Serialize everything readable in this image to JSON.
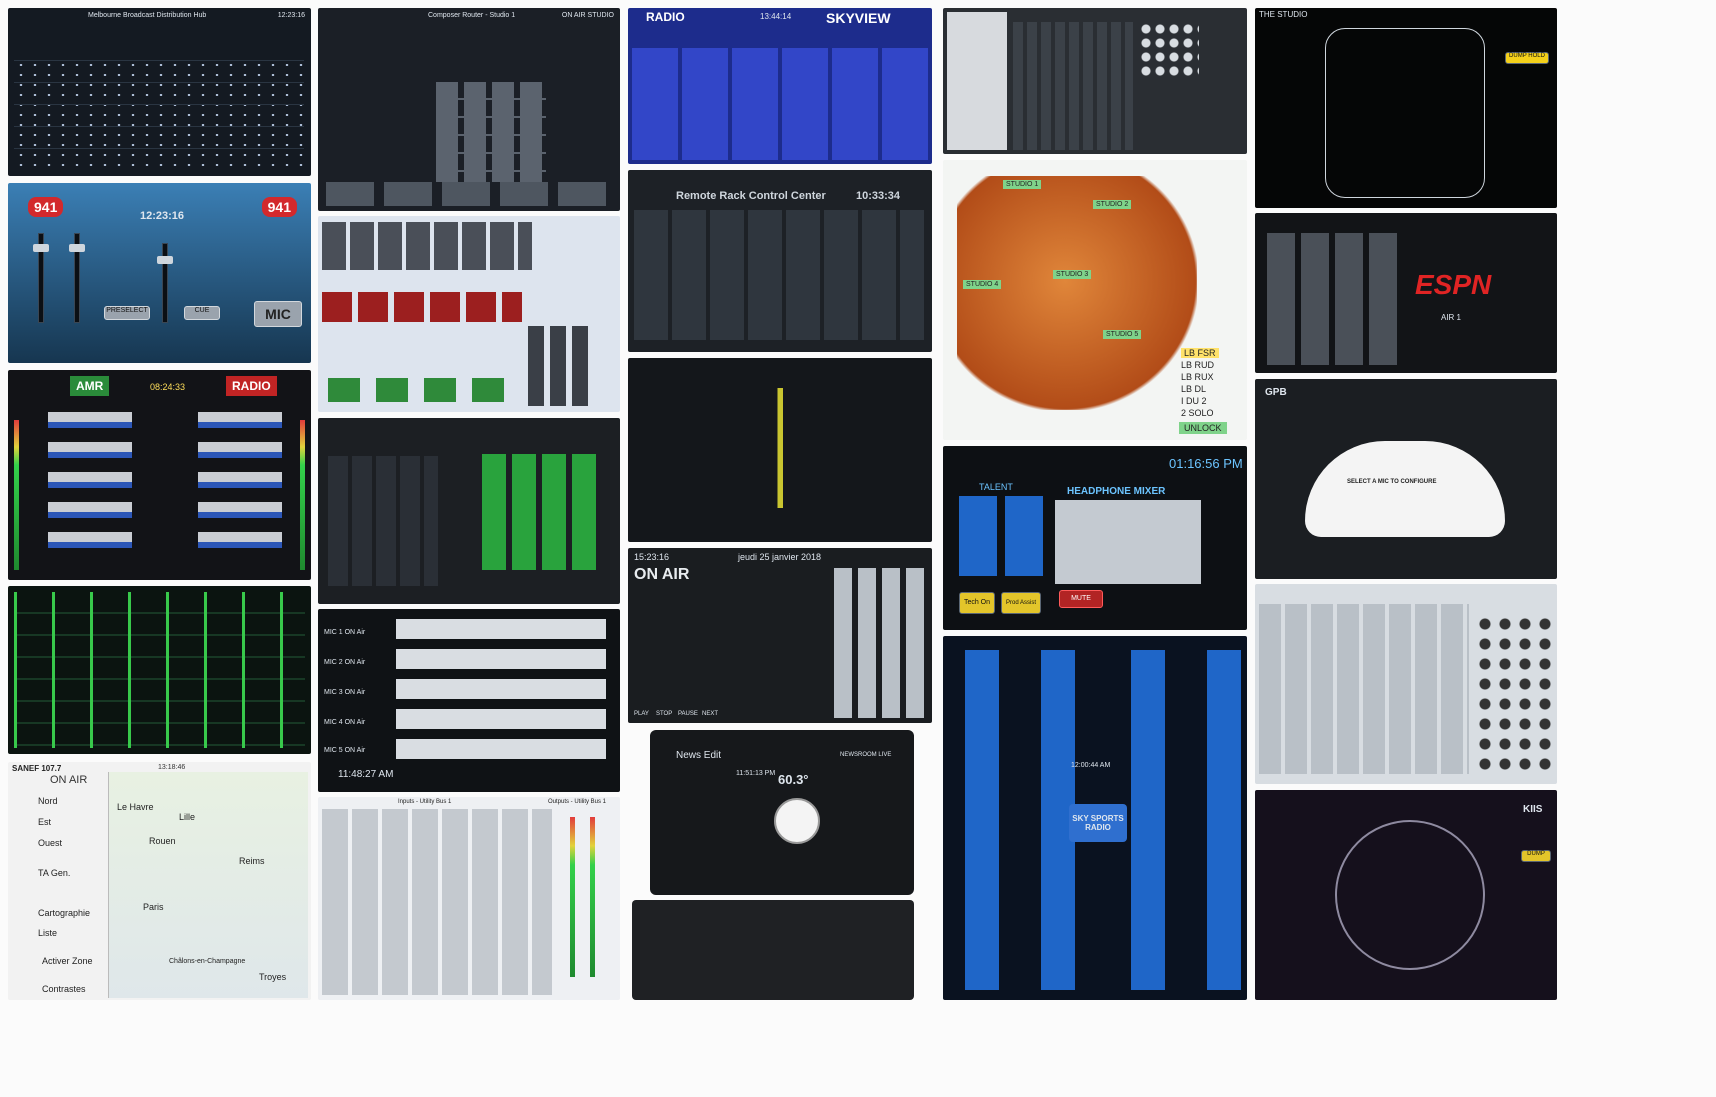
{
  "tiles": {
    "a1": {
      "title": "Melbourne Broadcast Distribution Hub",
      "clock": "12:23:16"
    },
    "a2": {
      "logo": "941",
      "clock": "12:23:16",
      "mic": "MIC",
      "btn1": "PRESELECT",
      "btn2": "CUE"
    },
    "a3": {
      "brand_left": "AMR",
      "brand_right": "RADIO",
      "clock": "08:24:33"
    },
    "a5": {
      "app_title": "SANEF 107.7",
      "status": "ON AIR",
      "clock": "13:18:46",
      "items": [
        "Nord",
        "Est",
        "Ouest",
        "TA Gen.",
        "Cartographie",
        "Liste",
        "Activer Zone",
        "Contrastes"
      ],
      "cities": [
        "Lille",
        "Reims",
        "Paris",
        "Le Havre",
        "Rouen",
        "Châlons-en-Champagne",
        "Troyes"
      ]
    },
    "b1": {
      "title": "Composer Router - Studio 1",
      "label": "ON AIR STUDIO"
    },
    "b5": {
      "clock": "11:48:27 AM",
      "rows": [
        "MIC 1 ON Air",
        "MIC 2 ON Air",
        "MIC 3 ON Air",
        "MIC 4 ON Air",
        "MIC 5 ON Air"
      ]
    },
    "b6": {
      "title_left": "Inputs - Utility Bus 1",
      "title_right": "Outputs - Utility Bus 1"
    },
    "c1": {
      "brand_left": "RADIO",
      "clock": "13:44:14",
      "brand_right": "SKYVIEW"
    },
    "c2": {
      "title": "Remote Rack Control Center",
      "clock": "10:33:34"
    },
    "c4": {
      "clock": "15:23:16",
      "date": "jeudi 25 janvier 2018",
      "status": "ON AIR",
      "transport": [
        "PLAY",
        "STOP",
        "PAUSE",
        "NEXT"
      ]
    },
    "c5": {
      "title": "News Edit",
      "time": "11:51:13 PM",
      "temp": "60.3°",
      "room": "NEWSROOM LIVE"
    },
    "d2": {
      "labels": [
        "STUDIO 1",
        "STUDIO 2",
        "STUDIO 3",
        "STUDIO 4",
        "STUDIO 5"
      ],
      "list": [
        "LB FSR",
        "LB RUD",
        "LB RUX",
        "LB DL",
        "I DU 2",
        "2 SOLO"
      ],
      "action": "UNLOCK"
    },
    "d3": {
      "clock": "01:16:56 PM",
      "talent": "TALENT",
      "mixer": "HEADPHONE MIXER",
      "btn1": "Tech On",
      "btn2": "Prod Assist",
      "mute": "MUTE"
    },
    "d4": {
      "clock": "12:00:44 AM",
      "logo": "SKY SPORTS RADIO"
    },
    "e1": {
      "brand": "THE STUDIO",
      "action": "DUMP HOLD"
    },
    "e2": {
      "brand": "ESPN",
      "sub": "AIR 1"
    },
    "e3": {
      "brand": "GPB",
      "prompt": "SELECT A MIC TO CONFIGURE"
    },
    "e5": {
      "brand": "KIIS",
      "action": "DUMP"
    }
  },
  "colors": {
    "green": "#2e8f3c",
    "red": "#b22424",
    "blue": "#1f66c8",
    "panel": "#141a22"
  }
}
